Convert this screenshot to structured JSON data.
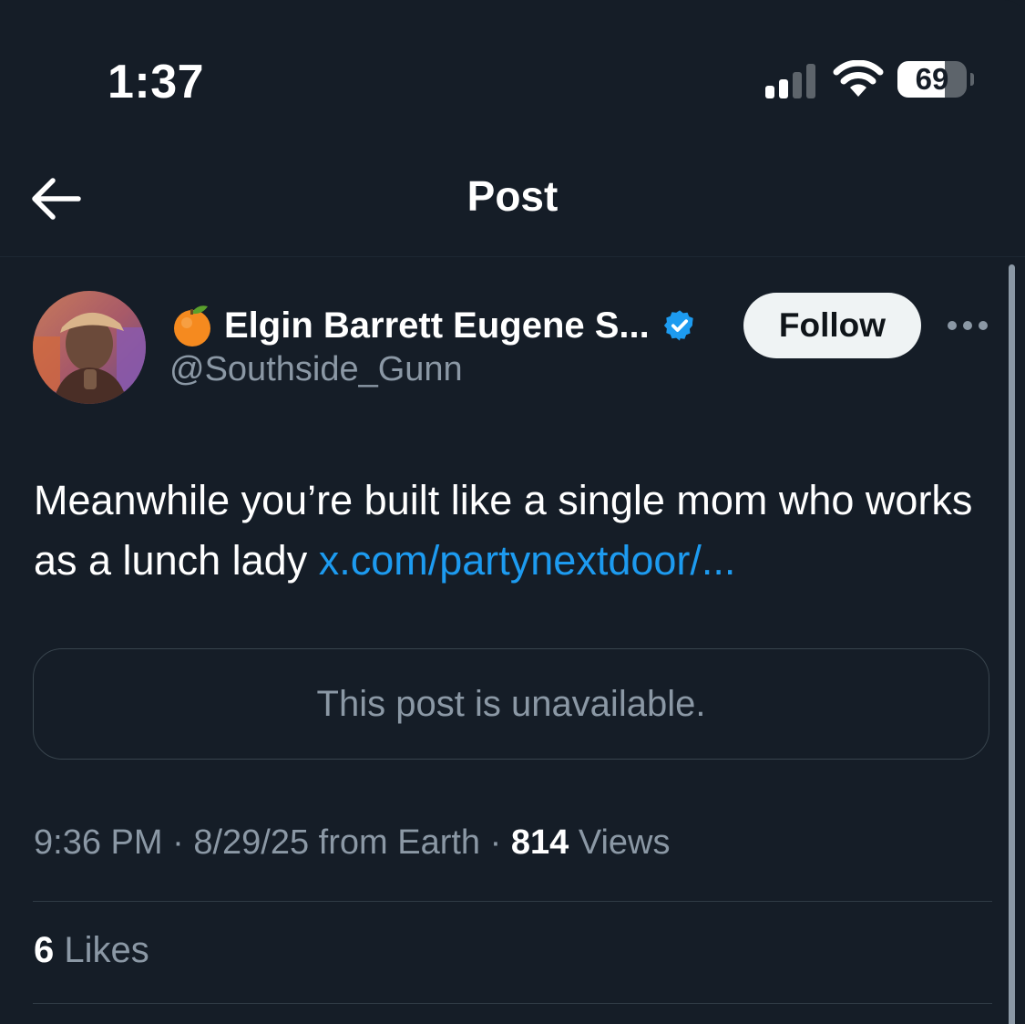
{
  "status_bar": {
    "time": "1:37",
    "battery": "69",
    "battery_level": 0.69
  },
  "header": {
    "title": "Post",
    "back_icon": "arrow-left-icon"
  },
  "post": {
    "author_emoji": "orange-emoji",
    "author_name": "Elgin Barrett Eugene S...",
    "verified_icon": "verified-badge-icon",
    "handle": "@Southside_Gunn",
    "follow_label": "Follow",
    "more_icon": "more-dots-icon",
    "text": "Meanwhile you’re built like a single mom who works as a lunch lady",
    "link": "x.com/partynextdoor/...",
    "quote_unavailable": "This post is unavailable.",
    "time": "9:36 PM",
    "separator": "·",
    "date": "8/29/25",
    "location": "from Earth",
    "views_count": "814",
    "views_label": "Views",
    "likes_count": "6",
    "likes_label": "Likes"
  },
  "colors": {
    "background": "#151d27",
    "link": "#1d9bf0",
    "verified": "#1d9bf0",
    "secondary_text": "#8b98a5",
    "border": "#38444d"
  }
}
